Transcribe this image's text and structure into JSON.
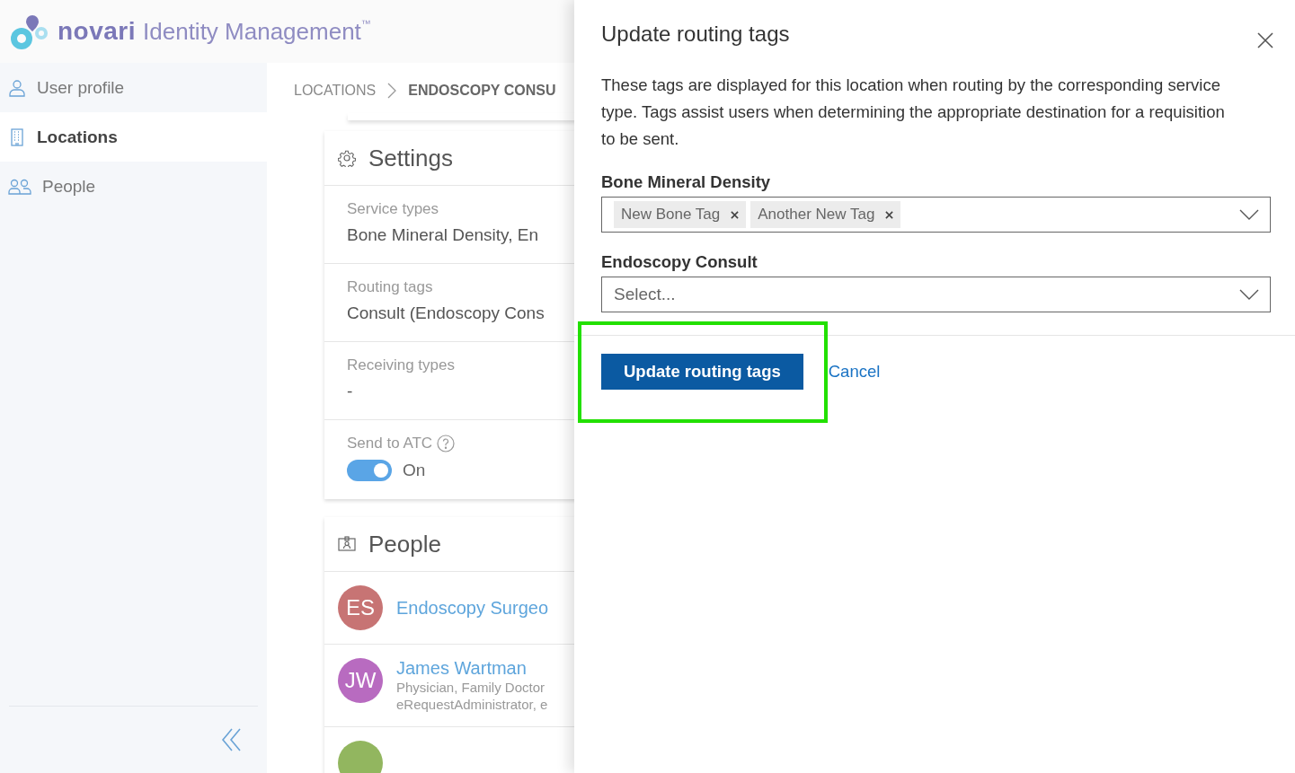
{
  "header": {
    "brand": "novari",
    "product": "Identity Management",
    "trademark": "™"
  },
  "sidebar": {
    "items": [
      {
        "label": "User profile",
        "kind": "user",
        "selected": false
      },
      {
        "label": "Locations",
        "kind": "building",
        "selected": true
      },
      {
        "label": "People",
        "kind": "people",
        "selected": false
      }
    ]
  },
  "breadcrumb": [
    "LOCATIONS",
    "ENDOSCOPY CONSU"
  ],
  "settings": {
    "title": "Settings",
    "fields": [
      {
        "label": "Service types",
        "value": "Bone Mineral Density, En"
      },
      {
        "label": "Routing tags",
        "value": "Consult (Endoscopy Cons"
      },
      {
        "label": "Receiving types",
        "value": "-"
      }
    ],
    "send_to_atc": {
      "label": "Send to ATC",
      "on": true,
      "state_text": "On"
    }
  },
  "people": {
    "title": "People",
    "items": [
      {
        "initials": "ES",
        "color": "#c77474",
        "name": "Endoscopy Surgeo"
      },
      {
        "initials": "JW",
        "color": "#b86bc0",
        "name": "James Wartman",
        "role": "Physician, Family Doctor",
        "groups": "eRequestAdministrator, e"
      },
      {
        "color": "#92b65f"
      }
    ]
  },
  "panel": {
    "title": "Update routing tags",
    "description": "These tags are displayed for this location when routing by the corresponding service type. Tags assist users when determining the appropriate destination for a requisition to be sent.",
    "selects": [
      {
        "label": "Bone Mineral Density",
        "tags": [
          "New Bone Tag",
          "Another New Tag"
        ]
      },
      {
        "label": "Endoscopy Consult",
        "placeholder": "Select..."
      }
    ],
    "primary_button": "Update routing tags",
    "cancel": "Cancel",
    "highlight": true
  }
}
